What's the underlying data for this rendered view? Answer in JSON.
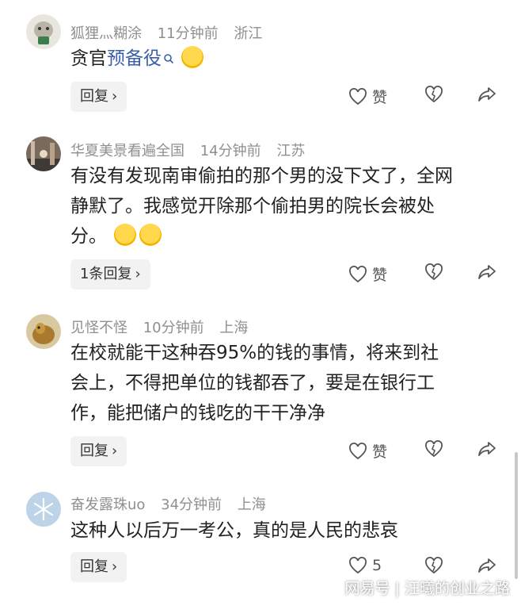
{
  "comments": [
    {
      "username": "狐狸灬糊涂",
      "time": "11分钟前",
      "location": "浙江",
      "text_before": "贪官",
      "link_text": "预备役",
      "text_after": "",
      "reply_label": "回复",
      "like_label": "赞"
    },
    {
      "username": "华夏美景看遍全国",
      "time": "14分钟前",
      "location": "江苏",
      "lines": [
        "有没有发现南审偷拍的那个男的没下文了，全网",
        "静默了。我感觉开除那个偷拍男的院长会被处",
        "分。"
      ],
      "reply_label": "1条回复",
      "like_label": "赞"
    },
    {
      "username": "见怪不怪",
      "time": "10分钟前",
      "location": "上海",
      "lines": [
        "在校就能干这种吞95%的钱的事情，将来到社",
        "会上，不得把单位的钱都吞了，要是在银行工",
        "作，能把储户的钱吃的干干净净"
      ],
      "reply_label": "回复",
      "like_label": "赞"
    },
    {
      "username": "奋发露珠uo",
      "time": "34分钟前",
      "location": "上海",
      "lines": [
        "这种人以后万一考公，真的是人民的悲哀"
      ],
      "reply_label": "回复",
      "like_label": "5"
    }
  ],
  "watermark": "网易号 | 汪曦的创业之路",
  "colors": {
    "link": "#3a5fa8",
    "meta": "#8f8f8f",
    "reply_bg": "#f2f2f2"
  }
}
